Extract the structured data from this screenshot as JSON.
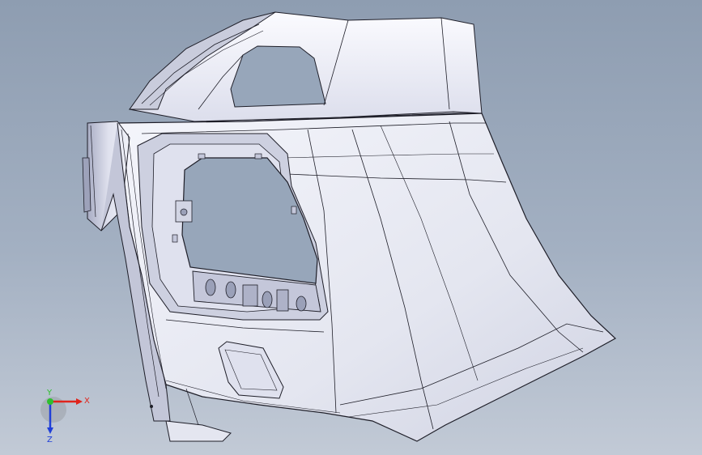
{
  "viewport": {
    "background_top": "#8e9db1",
    "background_bottom": "#c2cad6"
  },
  "model": {
    "description_icon": "bumper-part-3d",
    "surface_color": "#eceef6",
    "shade_color": "#b9bdd0",
    "edge_color": "#1e1e28"
  },
  "triad": {
    "x_label": "X",
    "y_label": "Y",
    "z_label": "Z",
    "x_color": "#e0241c",
    "y_color": "#2fbf2f",
    "z_color": "#1f3fd8"
  }
}
